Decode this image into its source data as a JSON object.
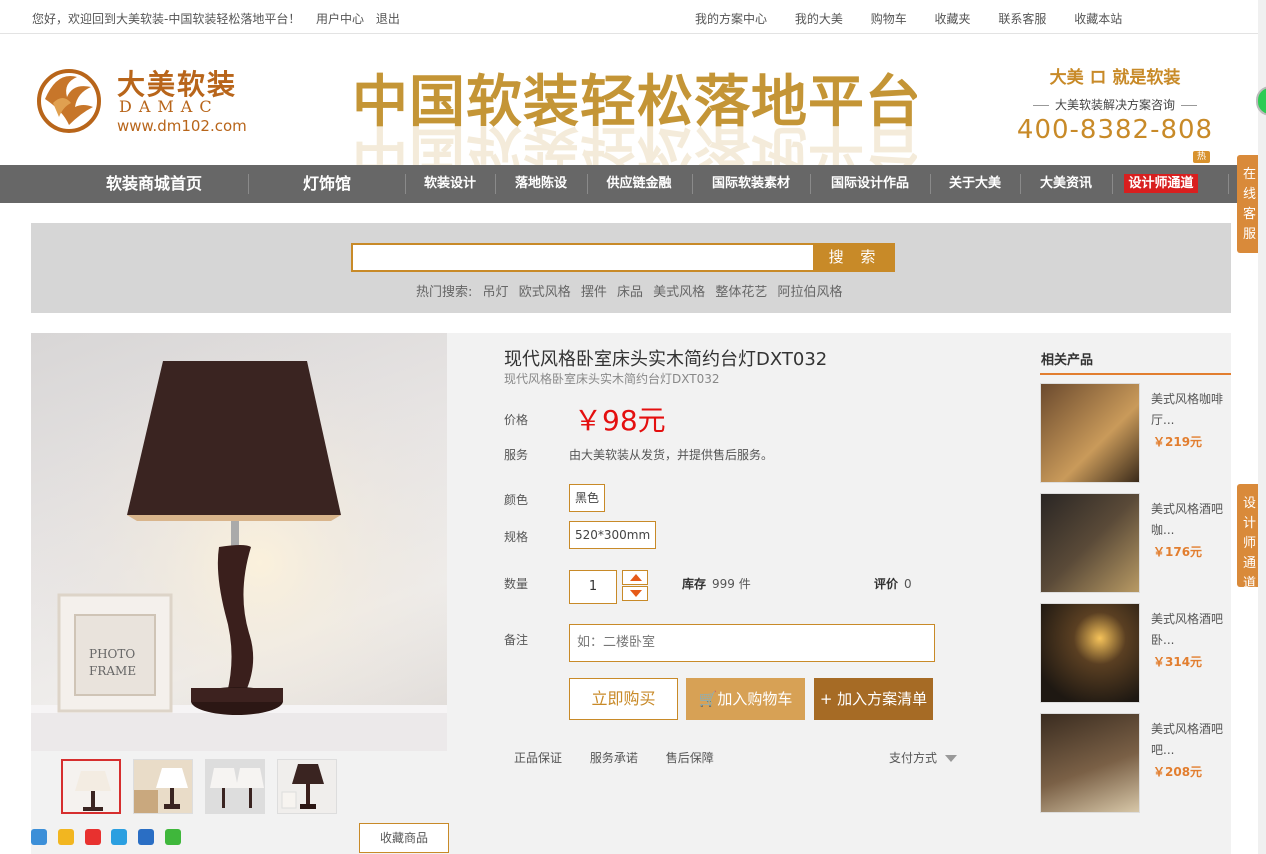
{
  "topbar": {
    "welcome": "您好，欢迎回到大美软装-中国软装轻松落地平台！",
    "user_center": "用户中心",
    "logout": "退出",
    "right_links": [
      "我的方案中心",
      "我的大美",
      "购物车",
      "收藏夹",
      "联系客服",
      "收藏本站"
    ]
  },
  "header": {
    "logo_cn": "大美软装",
    "logo_en": "DAMAC",
    "logo_url": "www.dm102.com",
    "slogan": "中国软装轻松落地平台",
    "hotline_title": "大美 ロ 就是软装",
    "hotline_sub": "大美软装解决方案咨询",
    "hotline_number": "400-8382-808"
  },
  "nav": {
    "items": [
      "软装商城首页",
      "灯饰馆",
      "软装设计",
      "落地陈设",
      "供应链金融",
      "国际软装素材",
      "国际设计作品",
      "关于大美",
      "大美资讯",
      "设计师通道"
    ],
    "hot_tag": "热"
  },
  "search": {
    "value": "",
    "button": "搜 索",
    "hot_label": "热门搜索:",
    "hot_terms": [
      "吊灯",
      "欧式风格",
      "摆件",
      "床品",
      "美式风格",
      "整体花艺",
      "阿拉伯风格"
    ]
  },
  "product": {
    "title": "现代风格卧室床头实木简约台灯DXT032",
    "subtitle": "现代风格卧室床头实木简约台灯DXT032",
    "price_label": "价格",
    "price": "￥98元",
    "service_label": "服务",
    "service": "由大美软装从发货，并提供售后服务。",
    "color_label": "颜色",
    "color": "黑色",
    "spec_label": "规格",
    "spec": "520*300mm",
    "qty_label": "数量",
    "qty": "1",
    "stock_label": "库存",
    "stock": "999 件",
    "rating_label": "评价",
    "rating": "0",
    "remark_label": "备注",
    "remark_placeholder": "如：二楼卧室",
    "buy_now": "立即购买",
    "add_cart": "加入购物车",
    "add_plan": "+ 加入方案清单",
    "guarantees": [
      "正品保证",
      "服务承诺",
      "售后保障"
    ],
    "payment": "支付方式",
    "collect": "收藏商品"
  },
  "related": {
    "title": "相关产品",
    "items": [
      {
        "name": "美式风格咖啡厅...",
        "price": "￥219元"
      },
      {
        "name": "美式风格酒吧咖...",
        "price": "￥176元"
      },
      {
        "name": "美式风格酒吧卧...",
        "price": "￥314元"
      },
      {
        "name": "美式风格酒吧吧...",
        "price": "￥208元"
      }
    ]
  },
  "side": {
    "online_service": "在线客服",
    "designer_channel": "设计师通道"
  },
  "colors": {
    "accent": "#c88a28",
    "price_red": "#e40f0f",
    "nav_bg": "#676767",
    "related_orange": "#e27e2f"
  },
  "icons": [
    "cart-icon",
    "share-plus-icon",
    "qzone-icon",
    "weibo-icon",
    "qq-icon",
    "renren-icon",
    "wechat-icon"
  ]
}
